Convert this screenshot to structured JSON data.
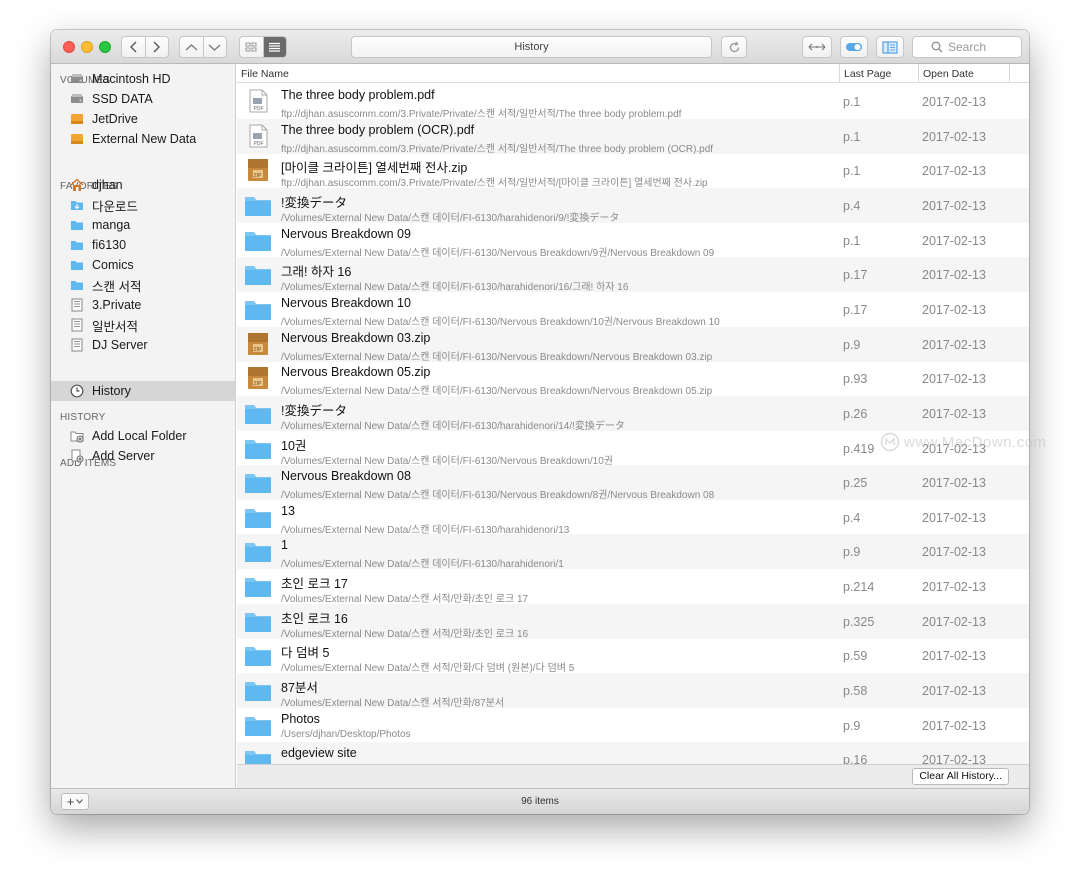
{
  "window": {
    "title": "History"
  },
  "toolbar": {
    "search_placeholder": "Search"
  },
  "sidebar": {
    "volumes_header": "VOLUMES",
    "volumes": [
      {
        "label": "Macintosh HD",
        "icon": "hard-drive-icon"
      },
      {
        "label": "SSD DATA",
        "icon": "hard-drive-icon"
      },
      {
        "label": "JetDrive",
        "icon": "external-drive-icon"
      },
      {
        "label": "External New Data",
        "icon": "external-drive-icon"
      }
    ],
    "favorites_header": "FAVORITES",
    "favorites": [
      {
        "label": "djhan",
        "icon": "home-icon"
      },
      {
        "label": "다운로드",
        "icon": "downloads-folder-icon"
      },
      {
        "label": "manga",
        "icon": "folder-icon"
      },
      {
        "label": "fi6130",
        "icon": "folder-icon"
      },
      {
        "label": "Comics",
        "icon": "folder-icon"
      },
      {
        "label": "스캔 서적",
        "icon": "folder-icon"
      },
      {
        "label": "3.Private",
        "icon": "server-icon"
      },
      {
        "label": "일반서적",
        "icon": "server-icon"
      },
      {
        "label": "DJ Server",
        "icon": "server-icon"
      }
    ],
    "history_header": "HISTORY",
    "history": [
      {
        "label": "History",
        "icon": "clock-icon"
      }
    ],
    "add_header": "ADD ITEMS",
    "add_items": [
      {
        "label": "Add Local Folder",
        "icon": "add-folder-icon"
      },
      {
        "label": "Add Server",
        "icon": "add-server-icon"
      }
    ]
  },
  "table": {
    "columns": [
      "File Name",
      "Last Page",
      "Open Date"
    ],
    "rows": [
      {
        "name": "The three body problem.pdf",
        "path": "ftp://djhan.asuscomm.com/3.Private/Private/스캔 서적/일반서적/The three body problem.pdf",
        "page": "p.1",
        "date": "2017-02-13",
        "type": "pdf"
      },
      {
        "name": "The three body problem (OCR).pdf",
        "path": "ftp://djhan.asuscomm.com/3.Private/Private/스캔 서적/일반서적/The three body problem (OCR).pdf",
        "page": "p.1",
        "date": "2017-02-13",
        "type": "pdf"
      },
      {
        "name": "[마이클 크라이튼] 열세번째 전사.zip",
        "path": "ftp://djhan.asuscomm.com/3.Private/Private/스캔 서적/일반서적/[마이클 크라이튼] 열세번째 전사.zip",
        "page": "p.1",
        "date": "2017-02-13",
        "type": "zip"
      },
      {
        "name": "!変換データ",
        "path": "/Volumes/External New Data/스캔 데이터/FI-6130/harahidenori/9/!変換データ",
        "page": "p.4",
        "date": "2017-02-13",
        "type": "folder"
      },
      {
        "name": "Nervous Breakdown 09",
        "path": "/Volumes/External New Data/스캔 데이터/FI-6130/Nervous Breakdown/9권/Nervous Breakdown 09",
        "page": "p.1",
        "date": "2017-02-13",
        "type": "folder"
      },
      {
        "name": "그래! 하자 16",
        "path": "/Volumes/External New Data/스캔 데이터/FI-6130/harahidenori/16/그래! 하자 16",
        "page": "p.17",
        "date": "2017-02-13",
        "type": "folder"
      },
      {
        "name": "Nervous Breakdown 10",
        "path": "/Volumes/External New Data/스캔 데이터/FI-6130/Nervous Breakdown/10권/Nervous Breakdown 10",
        "page": "p.17",
        "date": "2017-02-13",
        "type": "folder"
      },
      {
        "name": "Nervous Breakdown 03.zip",
        "path": "/Volumes/External New Data/스캔 데이터/FI-6130/Nervous Breakdown/Nervous Breakdown 03.zip",
        "page": "p.9",
        "date": "2017-02-13",
        "type": "zip"
      },
      {
        "name": "Nervous Breakdown 05.zip",
        "path": "/Volumes/External New Data/스캔 데이터/FI-6130/Nervous Breakdown/Nervous Breakdown 05.zip",
        "page": "p.93",
        "date": "2017-02-13",
        "type": "zip"
      },
      {
        "name": "!変換データ",
        "path": "/Volumes/External New Data/스캔 데이터/FI-6130/harahidenori/14/!変換データ",
        "page": "p.26",
        "date": "2017-02-13",
        "type": "folder"
      },
      {
        "name": "10권",
        "path": "/Volumes/External New Data/스캔 데이터/FI-6130/Nervous Breakdown/10권",
        "page": "p.419",
        "date": "2017-02-13",
        "type": "folder"
      },
      {
        "name": "Nervous Breakdown 08",
        "path": "/Volumes/External New Data/스캔 데이터/FI-6130/Nervous Breakdown/8권/Nervous Breakdown 08",
        "page": "p.25",
        "date": "2017-02-13",
        "type": "folder"
      },
      {
        "name": "13",
        "path": "/Volumes/External New Data/스캔 데이터/FI-6130/harahidenori/13",
        "page": "p.4",
        "date": "2017-02-13",
        "type": "folder"
      },
      {
        "name": "1",
        "path": "/Volumes/External New Data/스캔 데이터/FI-6130/harahidenori/1",
        "page": "p.9",
        "date": "2017-02-13",
        "type": "folder"
      },
      {
        "name": "초인 로크 17",
        "path": "/Volumes/External New Data/스캔 서적/만화/초인 로크 17",
        "page": "p.214",
        "date": "2017-02-13",
        "type": "folder"
      },
      {
        "name": "초인 로크 16",
        "path": "/Volumes/External New Data/스캔 서적/만화/초인 로크 16",
        "page": "p.325",
        "date": "2017-02-13",
        "type": "folder"
      },
      {
        "name": "다 덤벼 5",
        "path": "/Volumes/External New Data/스캔 서적/만화/다 덤벼 (원본)/다 덤벼 5",
        "page": "p.59",
        "date": "2017-02-13",
        "type": "folder"
      },
      {
        "name": "87분서",
        "path": "/Volumes/External New Data/스캔 서적/만화/87분서",
        "page": "p.58",
        "date": "2017-02-13",
        "type": "folder"
      },
      {
        "name": "Photos",
        "path": "/Users/djhan/Desktop/Photos",
        "page": "p.9",
        "date": "2017-02-13",
        "type": "folder"
      },
      {
        "name": "edgeview site",
        "path": "",
        "page": "p.16",
        "date": "2017-02-13",
        "type": "folder"
      }
    ]
  },
  "footer": {
    "clear_label": "Clear All History...",
    "item_count": "96 items"
  },
  "watermark": {
    "text": "www.MacDown.com"
  },
  "colors": {
    "folder": "#5fb8ef",
    "selection": "#d6d6d6",
    "sidebar_bg": "#f3f3f3"
  }
}
